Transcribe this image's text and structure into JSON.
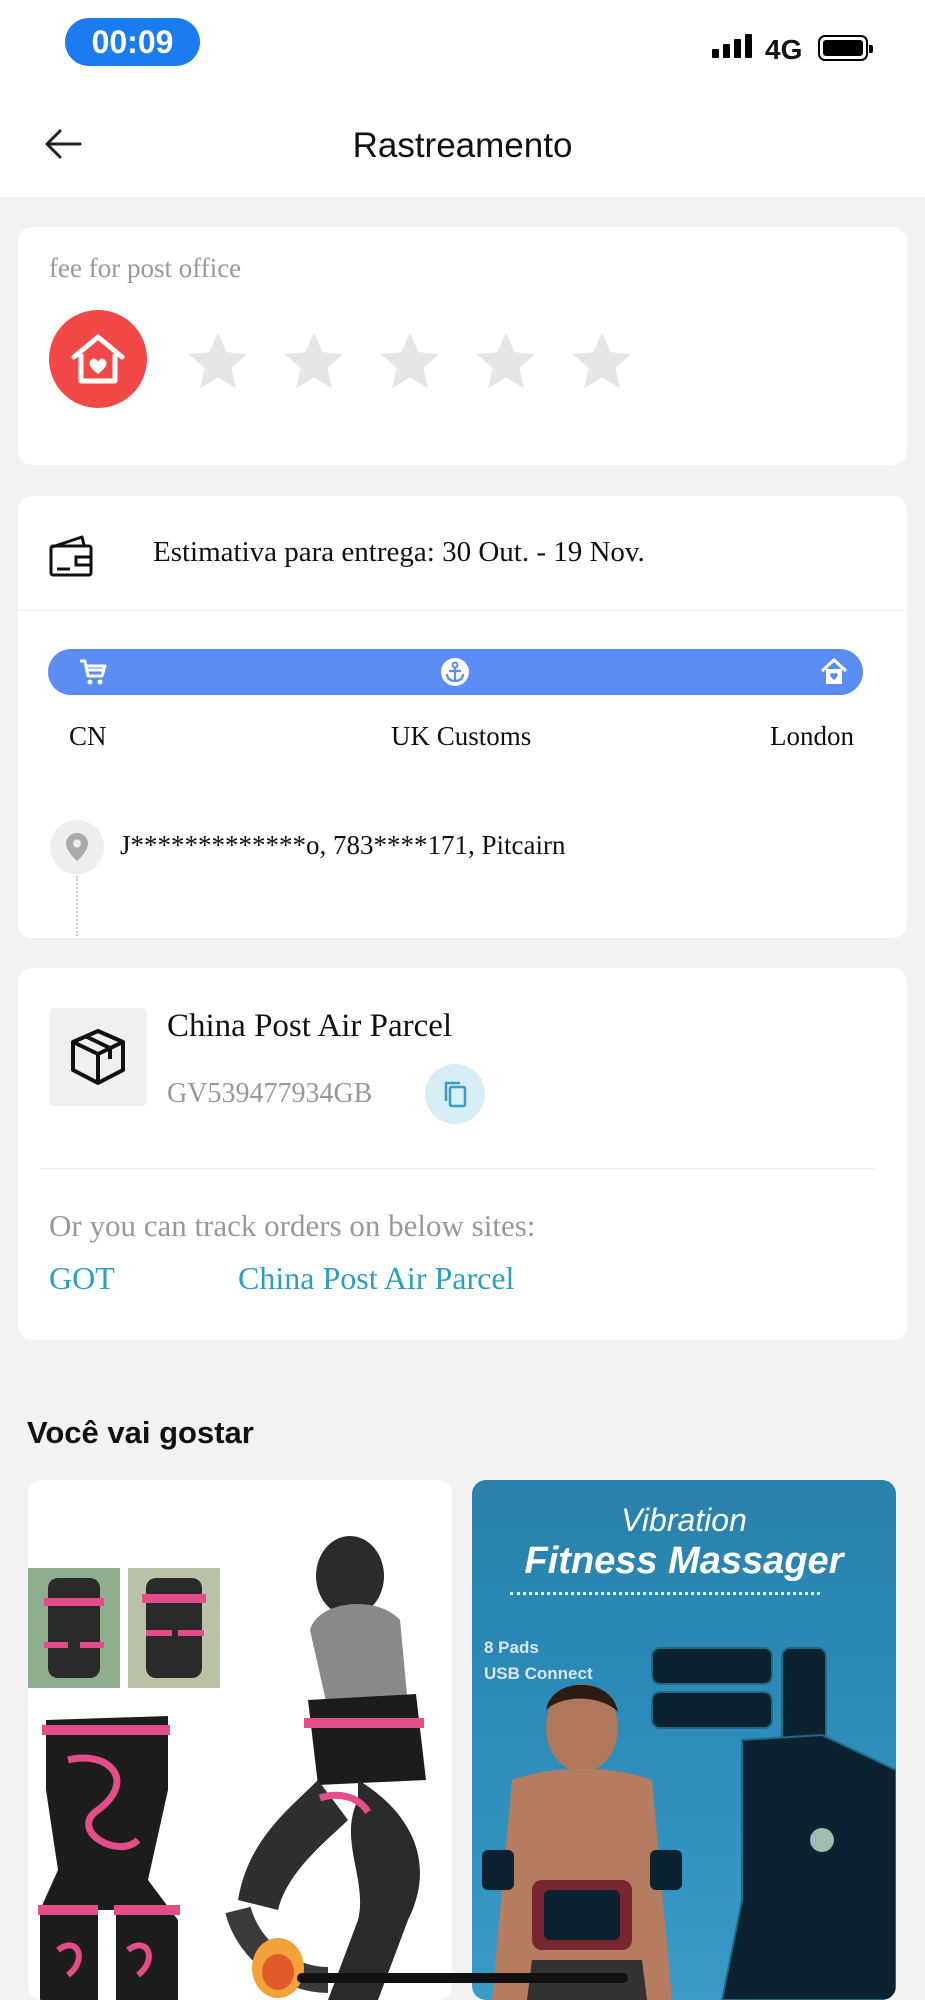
{
  "status_bar": {
    "time": "00:09",
    "network": "4G",
    "icons": [
      "signal-icon",
      "battery-icon"
    ]
  },
  "header": {
    "title": "Rastreamento",
    "back_icon": "arrow-left-icon"
  },
  "rating_card": {
    "label": "fee for post office",
    "icon": "home-heart-icon",
    "stars_total": 5,
    "stars_filled": 0,
    "colors": {
      "icon_bg": "#f24848",
      "star_empty": "#e6e6e6"
    }
  },
  "delivery_card": {
    "icon": "wallet-icon",
    "estimate": "Estimativa para entrega: 30 Out. - 19 Nov.",
    "progress_bar_color": "#5b8df5",
    "stops": [
      {
        "label": "CN",
        "icon": "cart-icon"
      },
      {
        "label": "UK Customs",
        "icon": "anchor-icon"
      },
      {
        "label": "London",
        "icon": "home-icon"
      }
    ],
    "address_icon": "location-pin-icon",
    "address": "J*************o,  783****171,  Pitcairn"
  },
  "carrier_card": {
    "icon": "package-box-icon",
    "carrier_name": "China Post Air Parcel",
    "tracking_number": "GV539477934GB",
    "copy_icon": "copy-icon",
    "note": "Or you can track orders on below sites:",
    "links": [
      "GOT",
      "China Post Air Parcel"
    ],
    "link_color": "#2a9fbf"
  },
  "recommendations": {
    "title": "Você vai gostar",
    "products": [
      {
        "image": "waist-trainer-belt-image"
      },
      {
        "image": "fitness-massager-image",
        "title_line1": "Vibration",
        "title_line2": "Fitness Massager",
        "feature1": "8 Pads",
        "feature2": "USB Connect"
      }
    ]
  }
}
